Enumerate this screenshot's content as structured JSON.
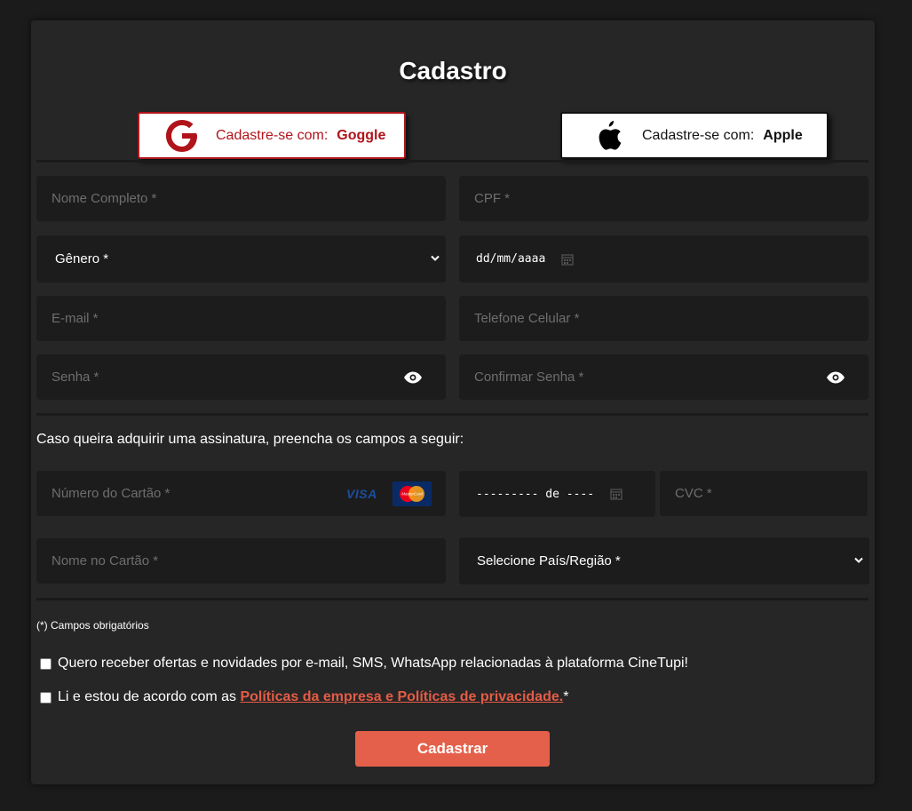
{
  "form": {
    "title": "Cadastro",
    "social": {
      "google": {
        "prefix": "Cadastre-se com:",
        "brand": "Goggle",
        "color": "#b0141b"
      },
      "apple": {
        "prefix": "Cadastre-se com:",
        "brand": "Apple"
      }
    },
    "fields": {
      "full_name": {
        "placeholder": "Nome Completo *"
      },
      "cpf": {
        "placeholder": "CPF *"
      },
      "gender": {
        "selected": "Gênero *"
      },
      "birth_date": {
        "placeholder": "dd/mm/aaaa"
      },
      "email": {
        "placeholder": "E-mail *"
      },
      "phone": {
        "placeholder": "Telefone Celular *"
      },
      "password": {
        "placeholder": "Senha *"
      },
      "confirm_password": {
        "placeholder": "Confirmar Senha *"
      }
    },
    "subscription": {
      "intro": "Caso queira adquirir uma assinatura, preencha os campos a seguir:",
      "card_number": {
        "placeholder": "Número do Cartão *",
        "visa_label": "VISA",
        "mastercard_label": "MasterCard"
      },
      "card_expiry": {
        "placeholder": "--------- de ----"
      },
      "cvc": {
        "placeholder": "CVC *"
      },
      "card_name": {
        "placeholder": "Nome no Cartão *"
      },
      "country": {
        "selected": "Selecione País/Região *"
      }
    },
    "required_note": "(*) Campos obrigatórios",
    "checkboxes": {
      "offers": {
        "label": "Quero receber ofertas e novidades por e-mail, SMS, WhatsApp relacionadas à plataforma CineTupi!"
      },
      "terms": {
        "prefix": "Li e estou de acordo com as",
        "link": "Políticas da empresa e Políticas de privacidade.",
        "suffix": "*"
      }
    },
    "submit_label": "Cadastrar",
    "accent_color": "#e5604a"
  }
}
